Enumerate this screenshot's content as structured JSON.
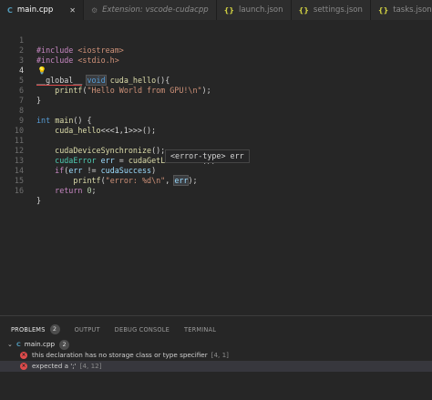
{
  "tabs": [
    {
      "icon": "C",
      "label": "main.cpp",
      "close": "✕"
    },
    {
      "icon": "⚙",
      "label": "Extension: vscode-cudacpp"
    },
    {
      "icon": "{}",
      "label": "launch.json"
    },
    {
      "icon": "{}",
      "label": "settings.json"
    },
    {
      "icon": "{}",
      "label": "tasks.json"
    }
  ],
  "editor": {
    "line_numbers": [
      "1",
      "2",
      "3",
      "4",
      "5",
      "6",
      "7",
      "8",
      "9",
      "10",
      "11",
      "12",
      "13",
      "14",
      "15",
      "16"
    ],
    "lines": {
      "l1": {
        "a": "#include",
        "b": " <iostream>"
      },
      "l2": {
        "a": "#include",
        "b": " <stdio.h>"
      },
      "l4": {
        "a": "__global__",
        "b": " ",
        "c": "void",
        "d": " ",
        "e": "cuda_hello",
        "f": "(){"
      },
      "l5": {
        "a": "    ",
        "b": "printf",
        "c": "(",
        "d": "\"Hello World from GPU!\\n\"",
        "e": ");"
      },
      "l6": {
        "a": "}"
      },
      "l8": {
        "a": "int",
        "b": " ",
        "c": "main",
        "d": "() {"
      },
      "l9": {
        "a": "    ",
        "b": "cuda_hello",
        "c": "<<<1,1>>>();"
      },
      "l11": {
        "a": "    ",
        "b": "cudaDeviceSynchronize",
        "c": "();"
      },
      "l12": {
        "a": "    ",
        "b": "cudaError",
        "c": " ",
        "d": "err",
        "e": " = ",
        "f": "cudaGetLastError",
        "g": "();"
      },
      "l13": {
        "a": "    ",
        "b": "if",
        "c": "(",
        "d": "err",
        "e": " != ",
        "f": "cudaSuccess",
        "g": ")"
      },
      "l14": {
        "a": "        ",
        "b": "printf",
        "c": "(",
        "d": "\"error: %d\\n\"",
        "e": ", ",
        "f": "err",
        "g": ");"
      },
      "l15": {
        "a": "    ",
        "b": "return",
        "c": " ",
        "d": "0",
        "e": ";"
      },
      "l16": {
        "a": "}"
      }
    },
    "bulb": "💡",
    "tooltip": "<error-type> err"
  },
  "panel": {
    "tabs": [
      {
        "label": "PROBLEMS",
        "badge": "2"
      },
      {
        "label": "OUTPUT"
      },
      {
        "label": "DEBUG CONSOLE"
      },
      {
        "label": "TERMINAL"
      }
    ],
    "file": {
      "chevron": "⌄",
      "icon": "C",
      "name": "main.cpp",
      "badge": "2"
    },
    "problems": [
      {
        "message": "this declaration has no storage class or type specifier",
        "location": "[4, 1]"
      },
      {
        "message": "expected a ';'",
        "location": "[4, 12]"
      }
    ],
    "error_glyph": "×"
  },
  "colors": {
    "background": "#262626",
    "error": "#e04b4b",
    "keyword": "#569cd6",
    "string": "#ce9178",
    "function": "#dcdcaa"
  }
}
